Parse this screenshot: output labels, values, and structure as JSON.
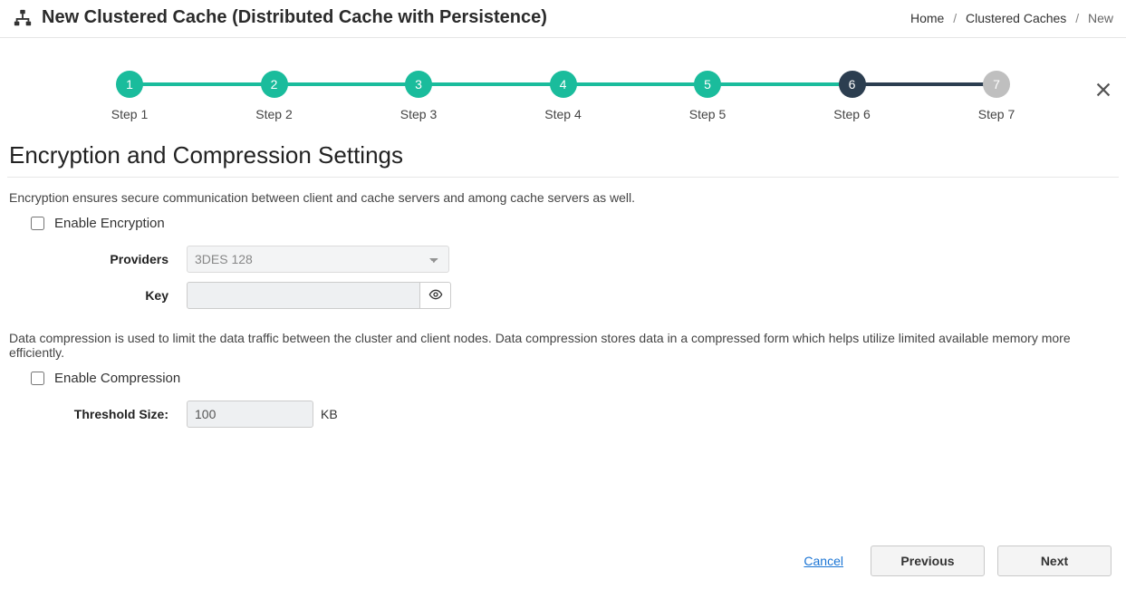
{
  "header": {
    "title": "New Clustered Cache (Distributed Cache with Persistence)"
  },
  "breadcrumb": {
    "home": "Home",
    "caches": "Clustered Caches",
    "current": "New"
  },
  "stepper": {
    "steps": [
      {
        "num": "1",
        "label": "Step 1",
        "state": "done"
      },
      {
        "num": "2",
        "label": "Step 2",
        "state": "done"
      },
      {
        "num": "3",
        "label": "Step 3",
        "state": "done"
      },
      {
        "num": "4",
        "label": "Step 4",
        "state": "done"
      },
      {
        "num": "5",
        "label": "Step 5",
        "state": "done"
      },
      {
        "num": "6",
        "label": "Step 6",
        "state": "current"
      },
      {
        "num": "7",
        "label": "Step 7",
        "state": "todo"
      }
    ],
    "segments": [
      "done",
      "done",
      "done",
      "done",
      "done",
      "current"
    ]
  },
  "section": {
    "title": "Encryption and Compression Settings",
    "encryption_desc": "Encryption ensures secure communication between client and cache servers and among cache servers as well.",
    "enable_encryption_label": "Enable Encryption",
    "providers_label": "Providers",
    "providers_value": "3DES 128",
    "key_label": "Key",
    "key_value": "",
    "compression_desc": "Data compression is used to limit the data traffic between the cluster and client nodes. Data compression stores data in a compressed form which helps utilize limited available memory more efficiently.",
    "enable_compression_label": "Enable Compression",
    "threshold_label": "Threshold Size:",
    "threshold_value": "100",
    "threshold_unit": "KB"
  },
  "footer": {
    "cancel": "Cancel",
    "previous": "Previous",
    "next": "Next"
  }
}
